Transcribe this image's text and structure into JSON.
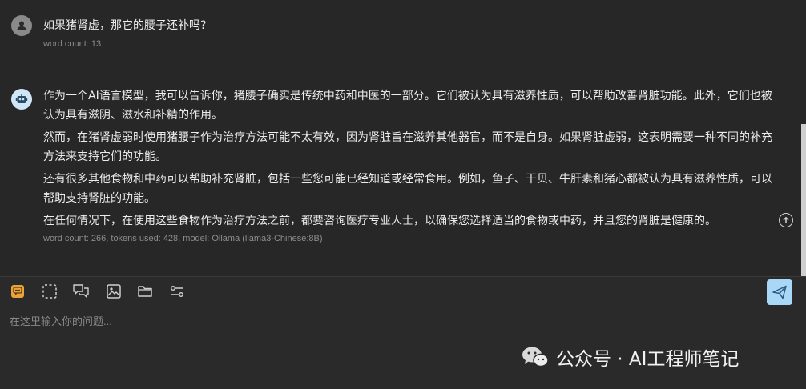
{
  "question": {
    "text": "如果猪肾虚，那它的腰子还补吗?",
    "meta": "word count: 13"
  },
  "answer": {
    "paragraphs": [
      "作为一个AI语言模型，我可以告诉你，猪腰子确实是传统中药和中医的一部分。它们被认为具有滋养性质，可以帮助改善肾脏功能。此外，它们也被认为具有滋阴、滋水和补精的作用。",
      "然而，在猪肾虚弱时使用猪腰子作为治疗方法可能不太有效，因为肾脏旨在滋养其他器官，而不是自身。如果肾脏虚弱，这表明需要一种不同的补充方法来支持它们的功能。",
      "还有很多其他食物和中药可以帮助补充肾脏，包括一些您可能已经知道或经常食用。例如，鱼子、干贝、牛肝素和猪心都被认为具有滋养性质，可以帮助支持肾脏的功能。",
      "在任何情况下，在使用这些食物作为治疗方法之前，都要咨询医疗专业人士，以确保您选择适当的食物或中药，并且您的肾脏是健康的。"
    ],
    "meta": "word count: 266, tokens used: 428, model: Ollama (llama3-Chinese:8B)"
  },
  "input": {
    "placeholder": "在这里输入你的问题..."
  },
  "watermark": {
    "text": "公众号 · AI工程师笔记"
  },
  "colors": {
    "background": "#272727",
    "accent": "#a9d7f6",
    "tool_active": "#e8a33b"
  },
  "icons": {
    "user_avatar": "person-icon",
    "bot_avatar": "robot-icon",
    "tools": [
      "prompt-icon",
      "select-area-icon",
      "chat-history-icon",
      "image-icon",
      "folder-icon",
      "settings-sliders-icon"
    ],
    "send": "send-icon",
    "scroll_top": "arrow-up-circle-icon",
    "watermark": "wechat-icon"
  }
}
